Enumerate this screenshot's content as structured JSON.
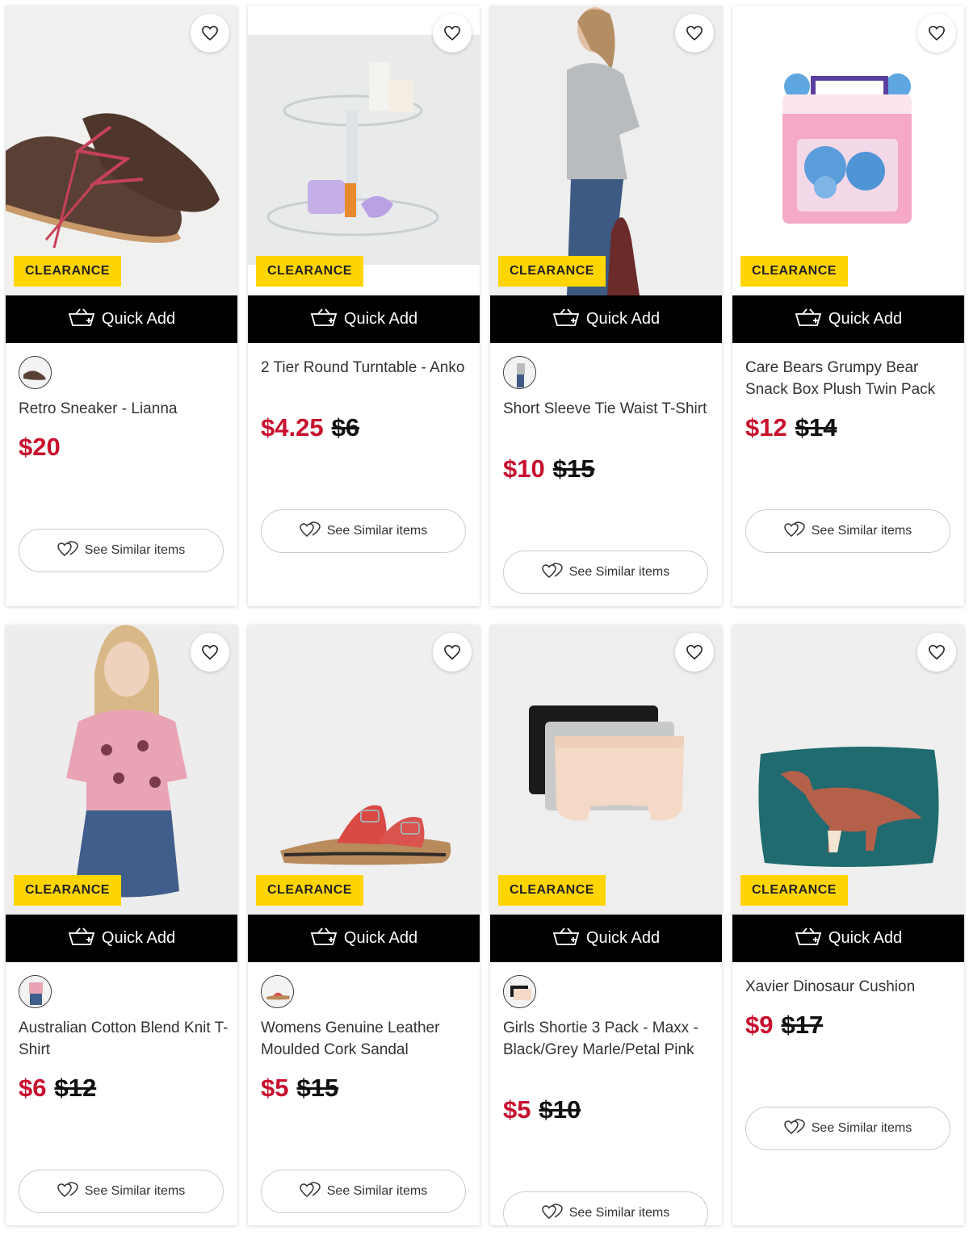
{
  "common": {
    "badge": "CLEARANCE",
    "quick_add": "Quick Add",
    "see_similar": "See Similar items"
  },
  "colors": {
    "sale": "#c8102e",
    "badge": "#ffd500",
    "quick_add_bg": "#000000"
  },
  "products": [
    {
      "title": "Retro Sneaker - Lianna",
      "price": "$20",
      "was": "",
      "has_swatch": true,
      "image": "brown-sneakers"
    },
    {
      "title": "2 Tier Round Turntable - Anko",
      "price": "$4.25",
      "was": "$6",
      "has_swatch": false,
      "image": "acrylic-turntable"
    },
    {
      "title": "Short Sleeve Tie Waist T-Shirt",
      "price": "$10",
      "was": "$15",
      "has_swatch": true,
      "image": "grey-tee-model"
    },
    {
      "title": "Care Bears Grumpy Bear Snack Box Plush Twin Pack",
      "price": "$12",
      "was": "$14",
      "has_swatch": false,
      "image": "care-bears-box"
    },
    {
      "title": "Australian Cotton Blend Knit T-Shirt",
      "price": "$6",
      "was": "$12",
      "has_swatch": true,
      "image": "pink-knit-girl"
    },
    {
      "title": "Womens Genuine Leather Moulded Cork Sandal",
      "price": "$5",
      "was": "$15",
      "has_swatch": true,
      "image": "red-cork-sandal"
    },
    {
      "title": "Girls Shortie 3 Pack - Maxx - Black/Grey Marle/Petal Pink",
      "price": "$5",
      "was": "$10",
      "has_swatch": true,
      "image": "shortie-3-pack"
    },
    {
      "title": "Xavier Dinosaur Cushion",
      "price": "$9",
      "was": "$17",
      "has_swatch": false,
      "image": "dinosaur-cushion"
    }
  ]
}
